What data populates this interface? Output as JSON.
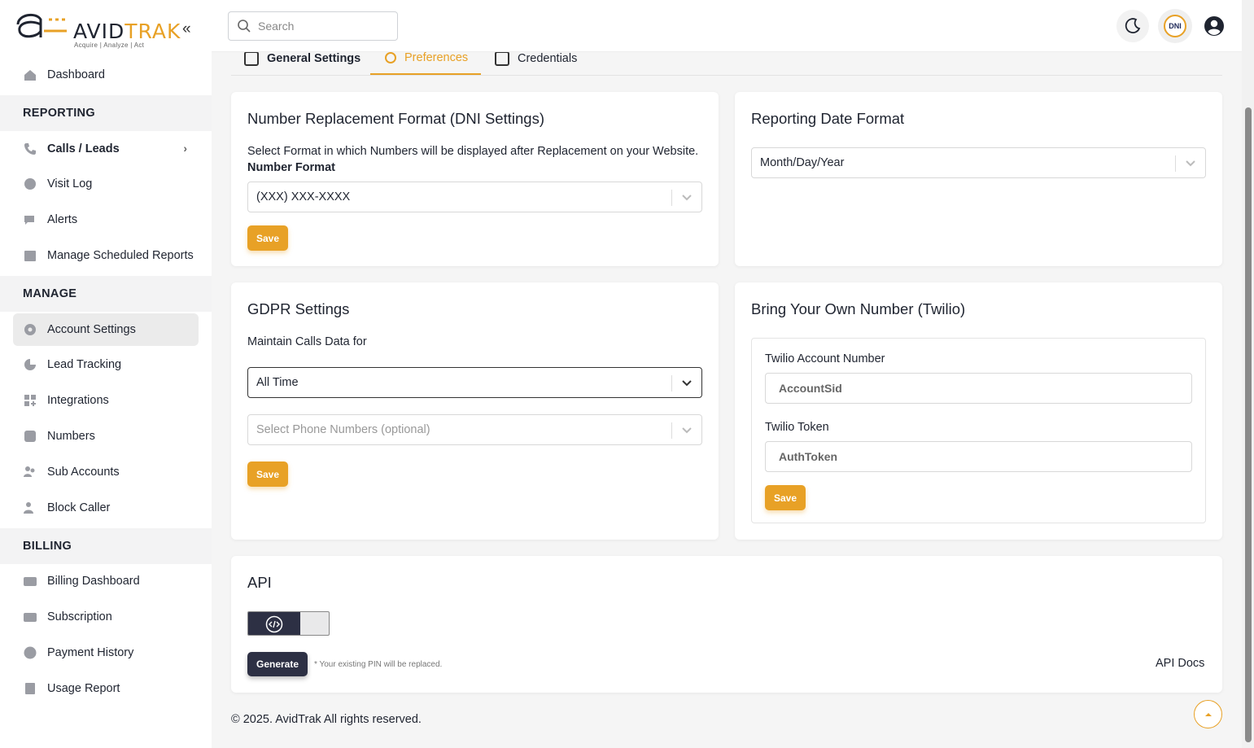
{
  "brand": {
    "name_part1": "AVID",
    "name_part2": "TRAK",
    "tagline": "Acquire  |  Analyze  |  Act",
    "accent_color": "#e8a126",
    "dark_color": "#2d3044"
  },
  "sidebar": {
    "collapse_icon": "double-chevron-left-icon",
    "dashboard": "Dashboard",
    "section_reporting": "REPORTING",
    "calls_leads": "Calls / Leads",
    "visit_log": "Visit Log",
    "alerts": "Alerts",
    "scheduled_reports": "Manage Scheduled Reports",
    "section_manage": "MANAGE",
    "account_settings": "Account Settings",
    "lead_tracking": "Lead Tracking",
    "integrations": "Integrations",
    "numbers": "Numbers",
    "sub_accounts": "Sub Accounts",
    "block_caller": "Block Caller",
    "section_billing": "BILLING",
    "billing_dashboard": "Billing Dashboard",
    "subscription": "Subscription",
    "payment_history": "Payment History",
    "usage_report": "Usage Report"
  },
  "topbar": {
    "search_placeholder": "Search",
    "dni_label": "DNI"
  },
  "tabs": {
    "general": "General Settings",
    "preferences": "Preferences",
    "credentials": "Credentials"
  },
  "dni_card": {
    "title": "Number Replacement Format (DNI Settings)",
    "description": "Select Format in which Numbers will be displayed after Replacement on your Website.",
    "field_label": "Number Format",
    "selected": "(XXX) XXX-XXXX",
    "save": "Save"
  },
  "date_card": {
    "title": "Reporting Date Format",
    "selected": "Month/Day/Year"
  },
  "gdpr_card": {
    "title": "GDPR Settings",
    "label": "Maintain Calls Data for",
    "selected": "All Time",
    "phone_placeholder": "Select Phone Numbers (optional)",
    "save": "Save"
  },
  "twilio_card": {
    "title": "Bring Your Own Number (Twilio)",
    "account_label": "Twilio Account Number",
    "account_placeholder": "AccountSid",
    "token_label": "Twilio Token",
    "token_placeholder": "AuthToken",
    "save": "Save"
  },
  "api_card": {
    "title": "API",
    "generate": "Generate",
    "note": "* Your existing PIN will be replaced.",
    "docs": "API Docs"
  },
  "footer": {
    "copyright": "© 2025. AvidTrak All rights reserved."
  }
}
